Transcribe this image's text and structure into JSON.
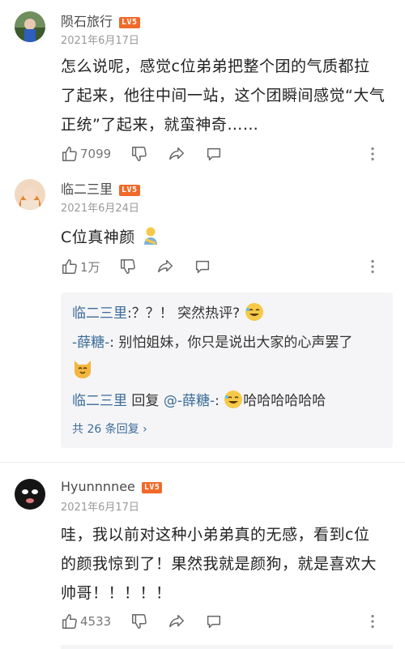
{
  "level_badge": "LV5",
  "comments": [
    {
      "user": "陨石旅行",
      "date": "2021年6月17日",
      "text_lines": [
        "怎么说呢，感觉c位弟弟把整个团的气质都拉",
        "了起来，他往中间一站，这个团瞬间感觉“大气",
        "正统”了起来，就蛮神奇……"
      ],
      "likes": "7099"
    },
    {
      "user": "临二三里",
      "date": "2021年6月24日",
      "text_lines": [
        "C位真神颜"
      ],
      "likes": "1万",
      "replies": {
        "r1_user": "临二三里",
        "r1_text": ":？？！ 突然热评?",
        "r2_user": "-薛糖-",
        "r2_text": ": 别怕姐妹，你只是说出大家的心声罢了",
        "r3_user": "临二三里",
        "r3_mid": " 回复 ",
        "r3_target": "@-薛糖-",
        "r3_text": "哈哈哈哈哈哈",
        "r3_colon": ": ",
        "total": "共 26 条回复"
      }
    },
    {
      "user": "Hyunnnnee",
      "date": "2021年6月17日",
      "text_lines": [
        "哇，我以前对这种小弟弟真的无感，看到c位",
        "的颜我惊到了！果然我就是颜狗，就是喜欢大",
        "帅哥！！！！！"
      ],
      "likes": "4533"
    }
  ],
  "icons": {
    "like": "thumbs-up-icon",
    "dislike": "thumbs-down-icon",
    "share": "share-arrow-icon",
    "comment": "comment-bubble-icon",
    "more": "more-dots-icon"
  }
}
